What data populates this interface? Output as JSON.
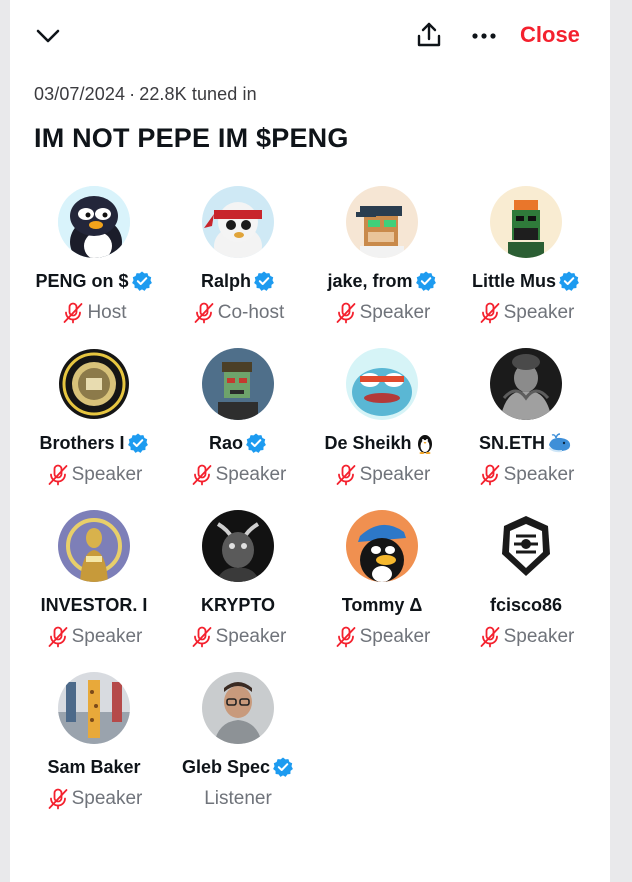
{
  "header": {
    "close_label": "Close",
    "chevron_icon": "chevron-down-icon",
    "share_icon": "share-icon",
    "more_icon": "more-icon",
    "accent_color": "#f4212e"
  },
  "space": {
    "date": "03/07/2024",
    "separator": "·",
    "tuned_in": "22.8K tuned in",
    "title": "IM NOT PEPE IM $PENG"
  },
  "participants": [
    {
      "name": "PENG on $",
      "role": "Host",
      "verified": true,
      "muted": true
    },
    {
      "name": "Ralph",
      "role": "Co-host",
      "verified": true,
      "muted": true
    },
    {
      "name": "jake, from",
      "role": "Speaker",
      "verified": true,
      "muted": true
    },
    {
      "name": "Little Mus",
      "role": "Speaker",
      "verified": true,
      "muted": true
    },
    {
      "name": "Brothers I",
      "role": "Speaker",
      "verified": true,
      "muted": true
    },
    {
      "name": "Rao",
      "role": "Speaker",
      "verified": true,
      "muted": true
    },
    {
      "name": "De Sheikh",
      "role": "Speaker",
      "verified": false,
      "muted": true,
      "emoji": "penguin-icon"
    },
    {
      "name": "SN.ETH",
      "role": "Speaker",
      "verified": false,
      "muted": true,
      "emoji": "whale-icon"
    },
    {
      "name": "INVESTOR. I",
      "role": "Speaker",
      "verified": false,
      "muted": true
    },
    {
      "name": "KRYPTO",
      "role": "Speaker",
      "verified": false,
      "muted": true
    },
    {
      "name": "Tommy Δ",
      "role": "Speaker",
      "verified": false,
      "muted": true
    },
    {
      "name": "fcisco86",
      "role": "Speaker",
      "verified": false,
      "muted": true
    },
    {
      "name": "Sam Baker",
      "role": "Speaker",
      "verified": false,
      "muted": true
    },
    {
      "name": "Gleb Spec",
      "role": "Listener",
      "verified": true,
      "muted": false
    }
  ],
  "colors": {
    "verified": "#1d9bf0",
    "muted_mic": "#f4212e",
    "role_text": "#6f737a"
  }
}
